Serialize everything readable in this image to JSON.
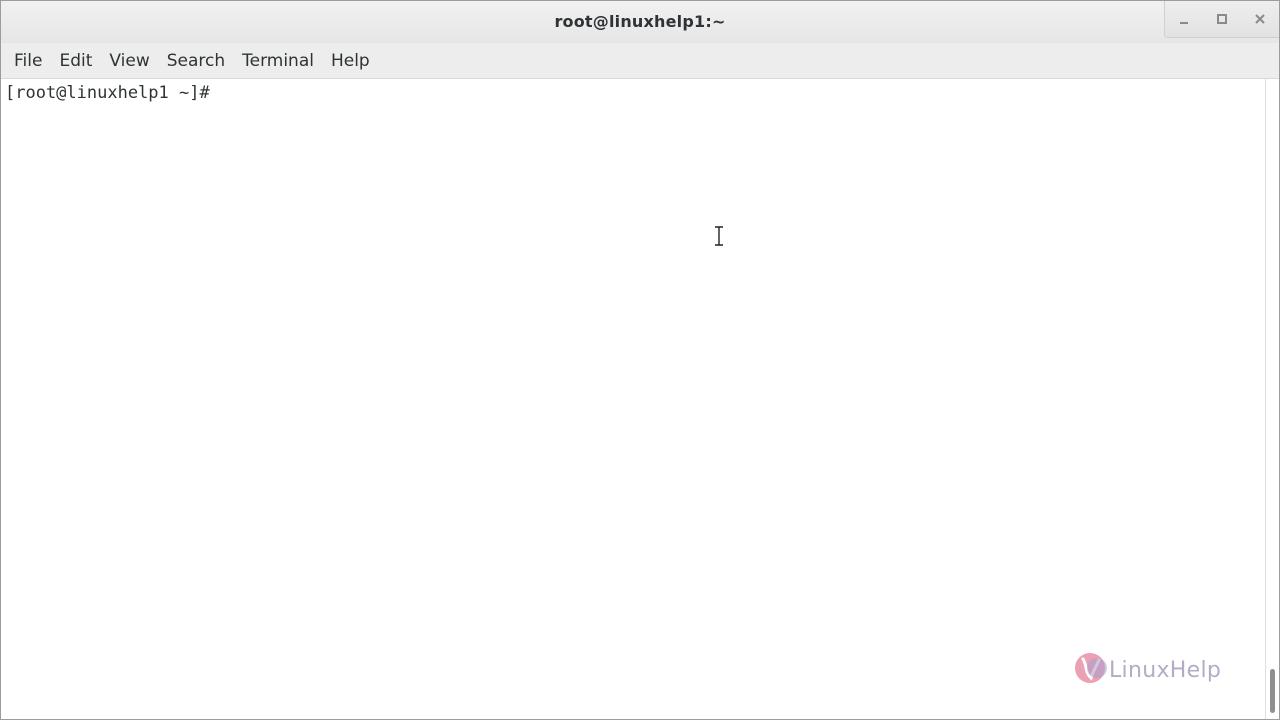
{
  "window": {
    "title": "root@linuxhelp1:~"
  },
  "menubar": {
    "items": [
      {
        "label": "File"
      },
      {
        "label": "Edit"
      },
      {
        "label": "View"
      },
      {
        "label": "Search"
      },
      {
        "label": "Terminal"
      },
      {
        "label": "Help"
      }
    ]
  },
  "terminal": {
    "prompt": "[root@linuxhelp1 ~]#"
  },
  "watermark": {
    "text": "LinuxHelp"
  },
  "icons": {
    "minimize": "minimize-icon",
    "maximize": "maximize-icon",
    "close": "close-icon",
    "cursor": "i-beam-cursor-icon",
    "logo": "linuxhelp-logo-icon"
  },
  "colors": {
    "titlebar": "#e6e6e6",
    "menubar": "#ededed",
    "text": "#2e3436",
    "background": "#ffffff"
  }
}
